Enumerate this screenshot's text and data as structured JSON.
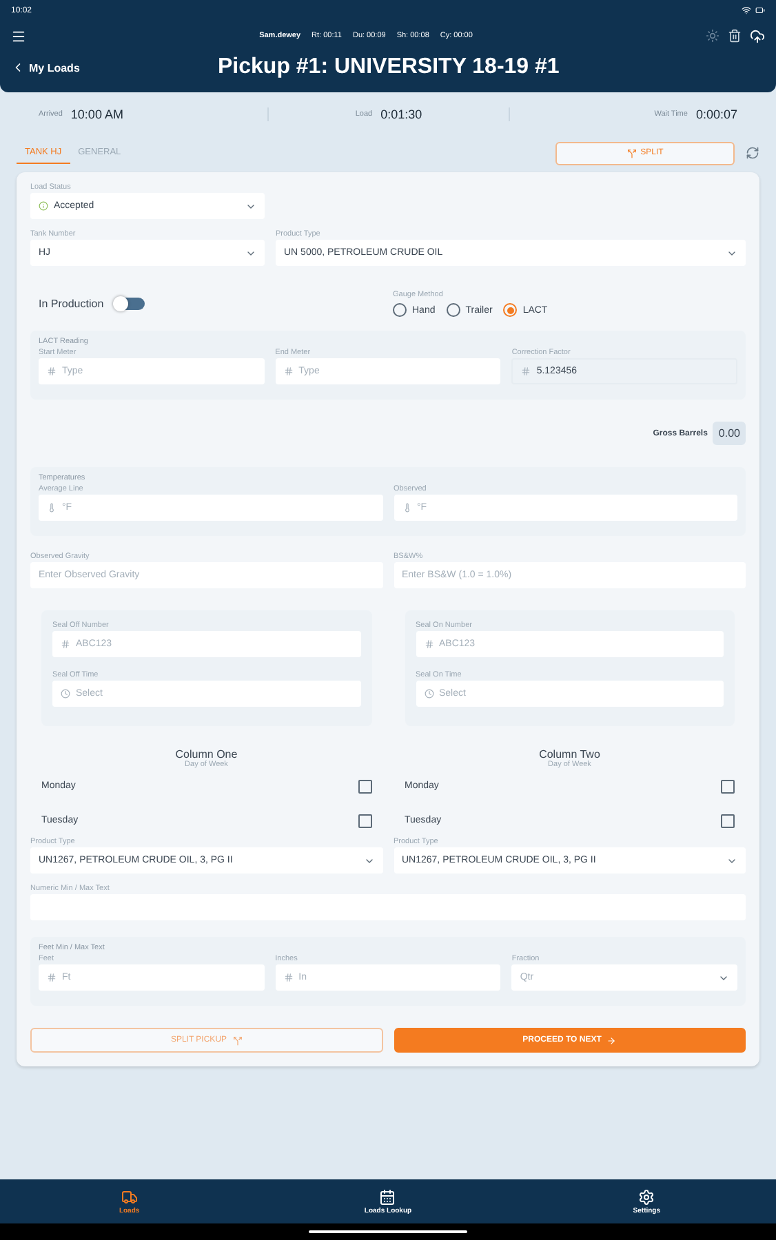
{
  "status_bar": {
    "time": "10:02"
  },
  "header": {
    "user": "Sam.dewey",
    "timers": [
      "Rt: 00:11",
      "Du: 00:09",
      "Sh: 00:08",
      "Cy: 00:00"
    ],
    "back_label": "My Loads",
    "title": "Pickup #1: UNIVERSITY 18-19 #1"
  },
  "times": [
    {
      "label": "Arrived",
      "value": "10:00 AM"
    },
    {
      "label": "Load",
      "value": "0:01:30"
    },
    {
      "label": "Wait Time",
      "value": "0:00:07"
    }
  ],
  "tabs": [
    {
      "label": "TANK HJ",
      "selected": true
    },
    {
      "label": "GENERAL",
      "selected": false
    }
  ],
  "split_button": "SPLIT",
  "load_status": {
    "label": "Load Status",
    "value": "Accepted",
    "kind": "status"
  },
  "tank_number": {
    "label": "Tank Number",
    "value": "HJ",
    "kind": "select"
  },
  "product_type": {
    "label": "Product Type",
    "value": "UN 5000, PETROLEUM CRUDE OIL",
    "kind": "select"
  },
  "in_production": {
    "label": "In Production",
    "on": false
  },
  "gauge_method": {
    "label": "Gauge Method",
    "options": [
      {
        "label": "Hand",
        "selected": false
      },
      {
        "label": "Trailer",
        "selected": false
      },
      {
        "label": "LACT",
        "selected": true
      }
    ]
  },
  "lact_reading": {
    "title": "LACT Reading",
    "fields": [
      {
        "label": "Start Meter",
        "placeholder": "Type",
        "kind": "number"
      },
      {
        "label": "End Meter",
        "placeholder": "Type",
        "kind": "number"
      },
      {
        "label": "Correction Factor",
        "value": "5.123456",
        "kind": "number",
        "disabled": true
      }
    ]
  },
  "gross_barrels": {
    "label": "Gross Barrels",
    "value": "0.00"
  },
  "temperatures": {
    "title": "Temperatures",
    "fields": [
      {
        "label": "Average Line",
        "placeholder": "°F",
        "kind": "temperature"
      },
      {
        "label": "Observed",
        "placeholder": "°F",
        "kind": "temperature"
      }
    ]
  },
  "gravity": [
    {
      "label": "Observed Gravity",
      "placeholder": "Enter Observed Gravity"
    },
    {
      "label": "BS&W%",
      "placeholder": "Enter BS&W (1.0 = 1.0%)"
    }
  ],
  "seals": [
    {
      "fields": [
        {
          "label": "Seal Off Number",
          "placeholder": "ABC123",
          "kind": "number"
        },
        {
          "label": "Seal Off Time",
          "placeholder": "Select",
          "kind": "time"
        }
      ]
    },
    {
      "fields": [
        {
          "label": "Seal On Number",
          "placeholder": "ABC123",
          "kind": "number"
        },
        {
          "label": "Seal On Time",
          "placeholder": "Select",
          "kind": "time"
        }
      ]
    }
  ],
  "columns": [
    {
      "title": "Column One",
      "subtitle": "Day of Week",
      "days": [
        {
          "label": "Monday",
          "checked": false
        },
        {
          "label": "Tuesday",
          "checked": false
        }
      ],
      "product_type": {
        "label": "Product Type",
        "value": "UN1267, PETROLEUM CRUDE OIL, 3, PG II",
        "kind": "select"
      }
    },
    {
      "title": "Column Two",
      "subtitle": "Day of Week",
      "days": [
        {
          "label": "Monday",
          "checked": false
        },
        {
          "label": "Tuesday",
          "checked": false
        }
      ],
      "product_type": {
        "label": "Product Type",
        "value": "UN1267, PETROLEUM CRUDE OIL, 3, PG II",
        "kind": "select"
      }
    }
  ],
  "numeric_text": {
    "label": "Numeric Min / Max Text"
  },
  "feet_text": {
    "title": "Feet Min / Max Text",
    "fields": [
      {
        "label": "Feet",
        "placeholder": "Ft",
        "kind": "number"
      },
      {
        "label": "Inches",
        "placeholder": "In",
        "kind": "number"
      },
      {
        "label": "Fraction",
        "placeholder": "Qtr",
        "kind": "select"
      }
    ]
  },
  "actions": [
    {
      "label": "SPLIT PICKUP",
      "kind": "secondary"
    },
    {
      "label": "PROCEED TO NEXT",
      "kind": "primary"
    }
  ],
  "bottom_nav": [
    {
      "label": "Loads",
      "selected": true
    },
    {
      "label": "Loads Lookup",
      "selected": false
    },
    {
      "label": "Settings",
      "selected": false
    }
  ]
}
